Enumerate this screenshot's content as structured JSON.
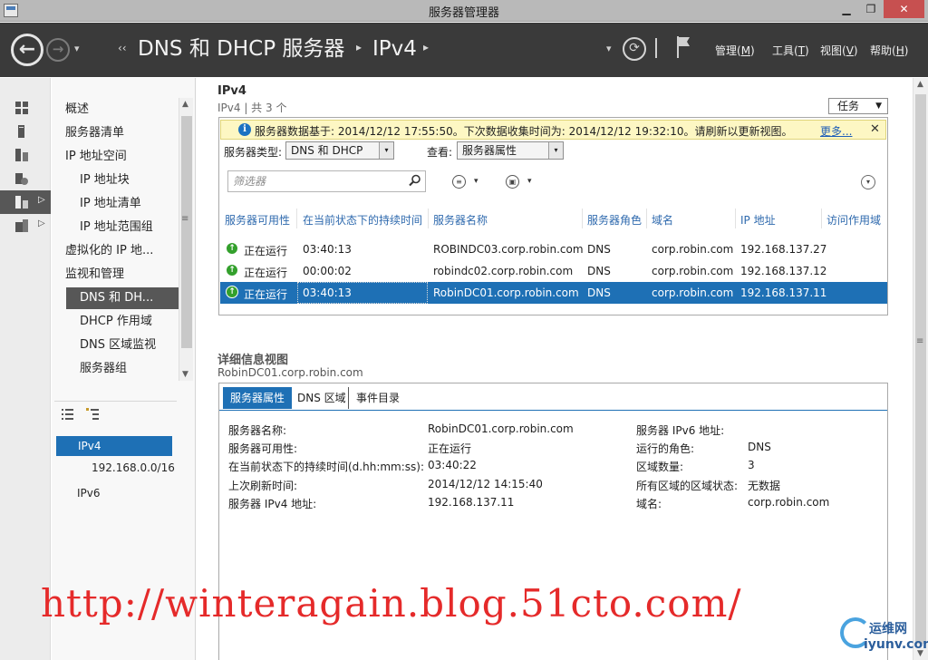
{
  "window": {
    "title": "服务器管理器",
    "minimize": "▁",
    "maximize": "❐",
    "close": "✕"
  },
  "header": {
    "back": "←",
    "forward": "→",
    "history_caret": "▾",
    "breadcrumb_lead": "‹‹",
    "breadcrumb": [
      "DNS 和 DHCP 服务器",
      "IPv4"
    ],
    "crumb_sep": "▸",
    "refresh_caret": "▾",
    "refresh": "⟳",
    "menus": {
      "manage": {
        "label": "管理(",
        "key": "M",
        "tail": ")"
      },
      "tools": {
        "label": "工具(",
        "key": "T",
        "tail": ")"
      },
      "view": {
        "label": "视图(",
        "key": "V",
        "tail": ")"
      },
      "help": {
        "label": "帮助(",
        "key": "H",
        "tail": ")"
      }
    }
  },
  "iconstrip": {
    "expand": "▷"
  },
  "navtree": {
    "items": [
      "概述",
      "服务器清单",
      "IP 地址空间",
      "IP 地址块",
      "IP 地址清单",
      "IP 地址范围组",
      "虚拟化的 IP 地...",
      "监视和管理",
      "DNS 和 DH...",
      "DHCP 作用域",
      "DNS 区域监视",
      "服务器组"
    ],
    "scroll_up": "▲",
    "scroll_down": "▼",
    "grip": "≡",
    "scopes": [
      "IPv4",
      "192.168.0.0/16",
      "IPv6"
    ]
  },
  "main": {
    "title": "IPv4",
    "subtitle": "IPv4 | 共 3 个",
    "tasks": "任务",
    "caret": "▼",
    "infobar": {
      "icon": "i",
      "message": "服务器数据基于: 2014/12/12 17:55:50。下次数据收集时间为: 2014/12/12 19:32:10。请刷新以更新视图。",
      "more": "更多...",
      "close": "✕"
    },
    "filters": {
      "type_label": "服务器类型:",
      "type_value": "DNS 和 DHCP",
      "view_label": "查看:",
      "view_value": "服务器属性",
      "caret": "▾"
    },
    "search": {
      "placeholder": "筛选器"
    },
    "toolbar": {
      "list_glyph": "≡",
      "save_glyph": "▣",
      "caret": "▾",
      "expand_glyph": "▾"
    },
    "columns": [
      "服务器可用性",
      "在当前状态下的持续时间",
      "服务器名称",
      "服务器角色",
      "域名",
      "IP 地址",
      "访问作用域"
    ],
    "rows": [
      {
        "status_icon": "↑",
        "status": "正在运行",
        "duration": "03:40:13",
        "name": "ROBINDC03.corp.robin.com",
        "role": "DNS",
        "domain": "corp.robin.com",
        "ip": "192.168.137.27",
        "scope": ""
      },
      {
        "status_icon": "↑",
        "status": "正在运行",
        "duration": "00:00:02",
        "name": "robindc02.corp.robin.com",
        "role": "DNS",
        "domain": "corp.robin.com",
        "ip": "192.168.137.12",
        "scope": ""
      },
      {
        "status_icon": "↑",
        "status": "正在运行",
        "duration": "03:40:13",
        "name": "RobinDC01.corp.robin.com",
        "role": "DNS",
        "domain": "corp.robin.com",
        "ip": "192.168.137.11",
        "scope": ""
      }
    ],
    "selected_row": 2,
    "scroll_up": "▲",
    "scroll_down": "▼",
    "grip": "≡"
  },
  "details": {
    "title": "详细信息视图",
    "subtitle": "RobinDC01.corp.robin.com",
    "tabs": [
      "服务器属性",
      "DNS 区域",
      "事件目录"
    ],
    "left": [
      {
        "label": "服务器名称:",
        "value": "RobinDC01.corp.robin.com"
      },
      {
        "label": "服务器可用性:",
        "value": "正在运行"
      },
      {
        "label": "在当前状态下的持续时间(d.hh:mm:ss):",
        "value": "03:40:22"
      },
      {
        "label": "上次刷新时间:",
        "value": "2014/12/12 14:15:40"
      },
      {
        "label": "服务器 IPv4 地址:",
        "value": "192.168.137.11"
      }
    ],
    "right": [
      {
        "label": "服务器 IPv6 地址:",
        "value": ""
      },
      {
        "label": "运行的角色:",
        "value": "DNS"
      },
      {
        "label": "区域数量:",
        "value": "3"
      },
      {
        "label": "所有区域的区域状态:",
        "value": "无数据"
      },
      {
        "label": "域名:",
        "value": "corp.robin.com"
      }
    ]
  },
  "watermark": {
    "text": "http://winteragain.blog.51cto.com/",
    "logo_name": "运维网",
    "logo_url": "iyunv.com"
  },
  "colors": {
    "accent": "#1e70b5",
    "header": "#3a3a3a",
    "info_bg": "#fdf7c3",
    "status_ok": "#33a02c",
    "watermark": "#e52a2a"
  }
}
